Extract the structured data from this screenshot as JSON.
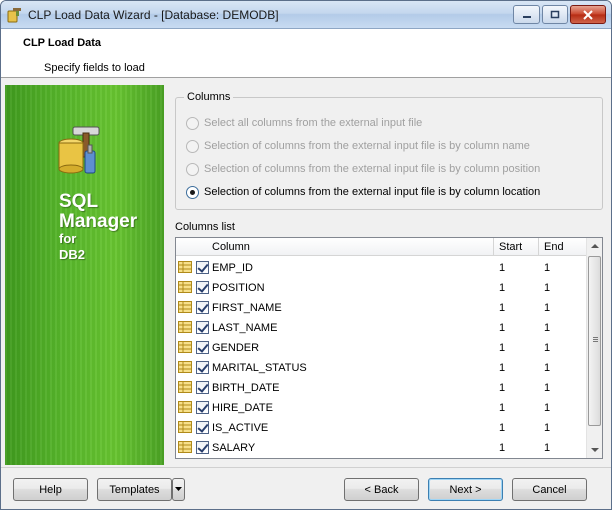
{
  "window": {
    "title": "CLP Load Data Wizard - [Database: DEMODB]"
  },
  "header": {
    "title": "CLP Load Data",
    "subtitle": "Specify fields to load"
  },
  "brand": {
    "line1": "SQL",
    "line2": "Manager",
    "line3": "for",
    "line4": "DB2"
  },
  "columns_group": {
    "caption": "Columns",
    "options": [
      {
        "label": "Select all columns from the external input file",
        "selected": false,
        "enabled": false
      },
      {
        "label": "Selection of columns from the external input file is by column name",
        "selected": false,
        "enabled": false
      },
      {
        "label": "Selection of columns from the external input file is by column position",
        "selected": false,
        "enabled": false
      },
      {
        "label": "Selection of columns from the external input file is by column location",
        "selected": true,
        "enabled": true
      }
    ]
  },
  "columns_list": {
    "label": "Columns list",
    "headers": {
      "column": "Column",
      "start": "Start",
      "end": "End"
    },
    "rows": [
      {
        "name": "EMP_ID",
        "start": "1",
        "end": "1",
        "checked": true
      },
      {
        "name": "POSITION",
        "start": "1",
        "end": "1",
        "checked": true
      },
      {
        "name": "FIRST_NAME",
        "start": "1",
        "end": "1",
        "checked": true
      },
      {
        "name": "LAST_NAME",
        "start": "1",
        "end": "1",
        "checked": true
      },
      {
        "name": "GENDER",
        "start": "1",
        "end": "1",
        "checked": true
      },
      {
        "name": "MARITAL_STATUS",
        "start": "1",
        "end": "1",
        "checked": true
      },
      {
        "name": "BIRTH_DATE",
        "start": "1",
        "end": "1",
        "checked": true
      },
      {
        "name": "HIRE_DATE",
        "start": "1",
        "end": "1",
        "checked": true
      },
      {
        "name": "IS_ACTIVE",
        "start": "1",
        "end": "1",
        "checked": true
      },
      {
        "name": "SALARY",
        "start": "1",
        "end": "1",
        "checked": true
      }
    ]
  },
  "buttons": {
    "help": "Help",
    "templates": "Templates",
    "back": "< Back",
    "next": "Next >",
    "cancel": "Cancel"
  },
  "colors": {
    "brand_green": "#56b52a",
    "title_bar": "#c4d7ee",
    "close_red": "#c8432a"
  }
}
